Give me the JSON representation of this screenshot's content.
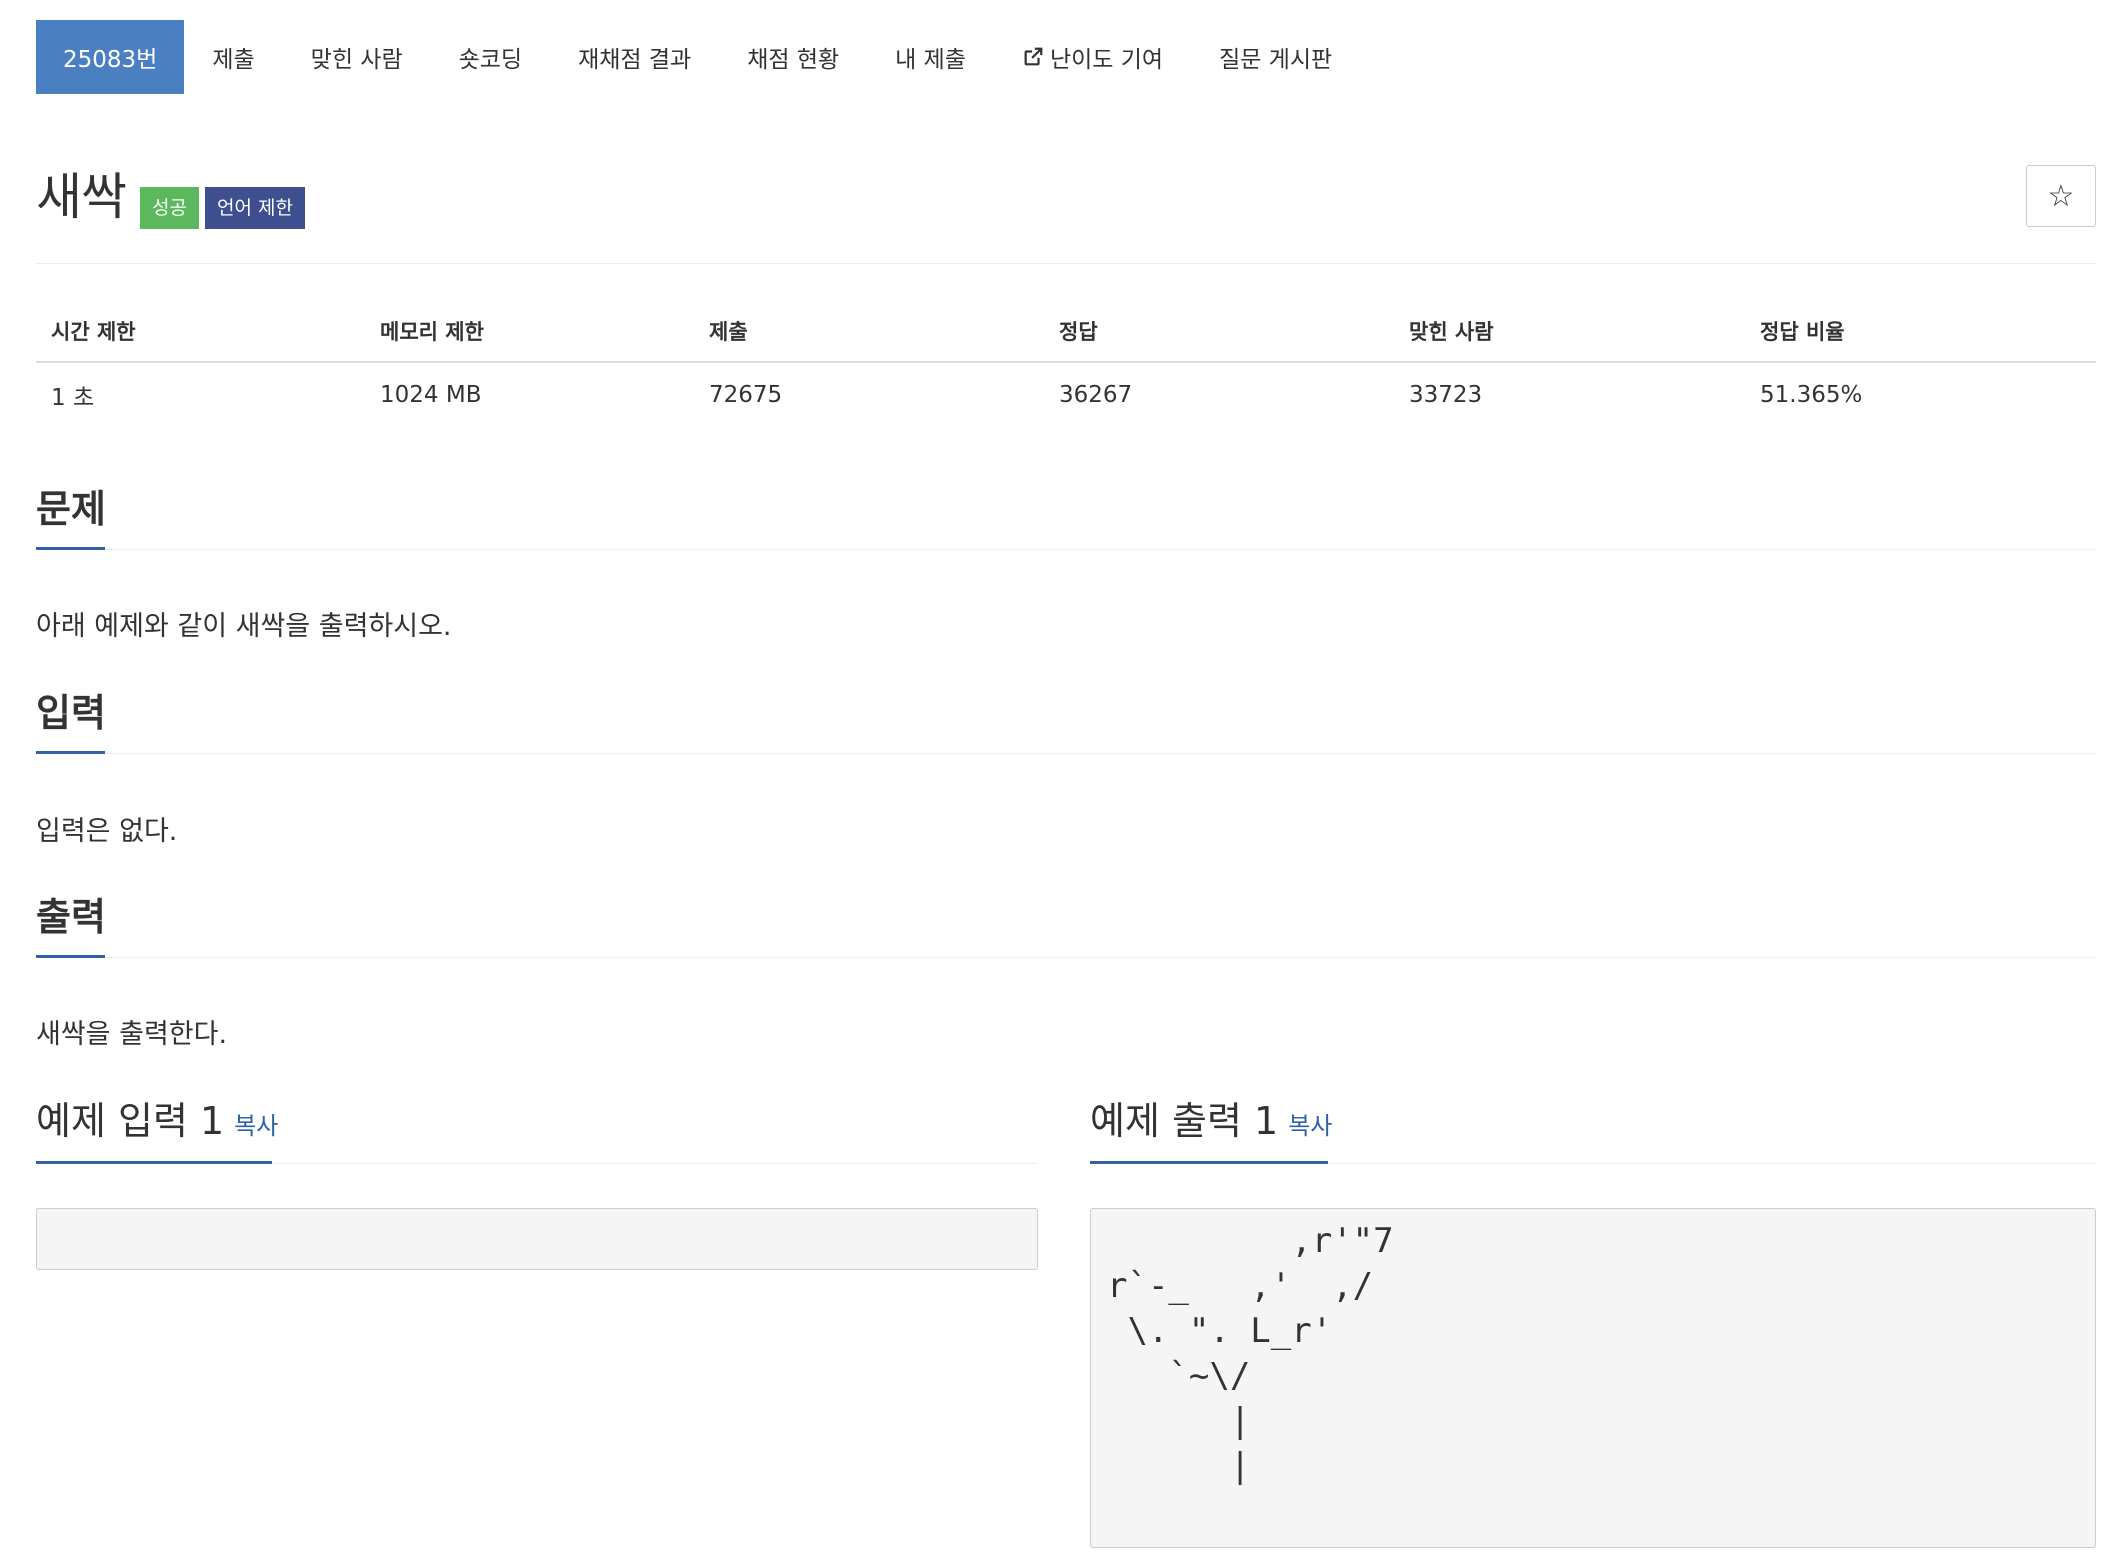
{
  "tabs": [
    {
      "label": "25083번",
      "active": true
    },
    {
      "label": "제출"
    },
    {
      "label": "맞힌 사람"
    },
    {
      "label": "숏코딩"
    },
    {
      "label": "재채점 결과"
    },
    {
      "label": "채점 현황"
    },
    {
      "label": "내 제출"
    },
    {
      "label": "난이도 기여",
      "icon": "external-link-icon"
    },
    {
      "label": "질문 게시판"
    }
  ],
  "problem": {
    "title": "새싹",
    "badge_success": "성공",
    "badge_lang": "언어 제한",
    "star_icon": "☆"
  },
  "info_table": {
    "headers": [
      "시간 제한",
      "메모리 제한",
      "제출",
      "정답",
      "맞힌 사람",
      "정답 비율"
    ],
    "values": [
      "1 초",
      "1024 MB",
      "72675",
      "36267",
      "33723",
      "51.365%"
    ]
  },
  "sections": {
    "problem": {
      "title": "문제",
      "text": "아래 예제와 같이 새싹을 출력하시오."
    },
    "input": {
      "title": "입력",
      "text": "입력은 없다."
    },
    "output": {
      "title": "출력",
      "text": "새싹을 출력한다."
    }
  },
  "samples": {
    "input": {
      "title": "예제 입력 1",
      "copy_label": "복사",
      "content": ""
    },
    "output": {
      "title": "예제 출력 1",
      "copy_label": "복사",
      "content": "         ,r'\"7\nr`-_   ,'  ,/\n \\. \". L_r'\n   `~\\/\n      |\n      |"
    }
  },
  "colors": {
    "active_tab": "#4a7fc1",
    "badge_success": "#5cb85c",
    "badge_lang": "#3d4f8f",
    "link": "#3162a8"
  }
}
